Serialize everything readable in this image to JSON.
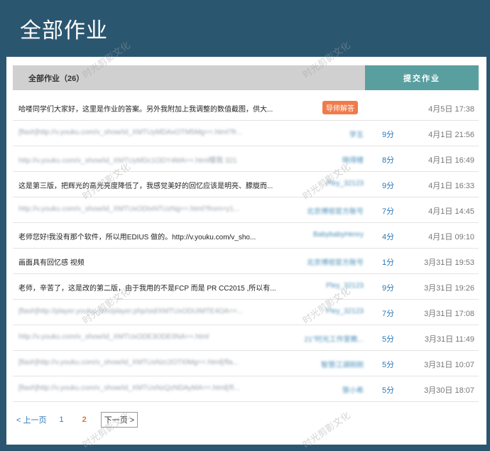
{
  "page": {
    "title": "全部作业"
  },
  "tabs": {
    "all_label": "全部作业（26）",
    "submit_label": "提交作业"
  },
  "badge_label": "导师解答",
  "rows": [
    {
      "title": "哈喽同学们大家好，这里是作业的答案。另外我附加上我调整的数值截图，供大...",
      "blurred": false,
      "author": "",
      "score": "",
      "time": "4月5日 17:38",
      "badge": true
    },
    {
      "title": "[flash]http://v.youku.com/v_show/id_XMTUyMDAxOTM5Mg==.html?fr...",
      "blurred": true,
      "author": "学五",
      "score": "9分",
      "time": "4月1日 21:56",
      "badge": false
    },
    {
      "title": "http://v.youku.com/v_show/id_XMTUyMDc1ODY4MA==.html曝我  321",
      "blurred": true,
      "author": "晓得楼",
      "score": "8分",
      "time": "4月1日 16:49",
      "badge": false
    },
    {
      "title": "这是第三版，把辉光的高光亮度降低了，我感觉美好的回忆应该是明亮、朦胧而...",
      "blurred": false,
      "author": "Pley_32123",
      "score": "9分",
      "time": "4月1日 16:33",
      "badge": false
    },
    {
      "title": "http://v.youku.com/v_show/id_XMTUxODIxNTUzNg==.html?from=y1...",
      "blurred": true,
      "author": "北京博视官方账号",
      "score": "7分",
      "time": "4月1日 14:45",
      "badge": false
    },
    {
      "title": "老师您好!我没有那个软件，所以用EDIUS 做的。http://v.youku.com/v_sho...",
      "blurred": false,
      "author": "BabybabyHenry",
      "score": "4分",
      "time": "4月1日 09:10",
      "badge": false
    },
    {
      "title": "画面具有回忆感 视频",
      "blurred": false,
      "author": "北京博视官方账号",
      "score": "1分",
      "time": "3月31日 19:53",
      "badge": false
    },
    {
      "title": "老师，辛苦了，这是改的第二版，由于我用的不是FCP 而是 PR CC2015 ,所以有...",
      "blurred": false,
      "author": "Pley_32123",
      "score": "9分",
      "time": "3月31日 19:26",
      "badge": false
    },
    {
      "title": "[flash]http://player.youku.com/player.php/sid/XMTUxODUIMTE4OA==...",
      "blurred": true,
      "author": "Pley_32123",
      "score": "7分",
      "time": "3月31日 17:08",
      "badge": false
    },
    {
      "title": "http://v.youku.com/v_show/id_XMTUxODE3ODE0NA==.html",
      "blurred": true,
      "author": "21°时光工作室教...",
      "score": "5分",
      "time": "3月31日 11:49",
      "badge": false
    },
    {
      "title": "[flash]http://v.youku.com/v_show/id_XMTUxNzc2OTI0Mg==.html[/fla...",
      "blurred": true,
      "author": "智慧江湖刚刚",
      "score": "5分",
      "time": "3月31日 10:07",
      "badge": false
    },
    {
      "title": "[flash]http://v.youku.com/v_show/id_XMTUxNzQzNDAyMA==.html[/fl...",
      "blurred": true,
      "author": "張小希",
      "score": "5分",
      "time": "3月30日 18:07",
      "badge": false
    }
  ],
  "pager": {
    "prev": "< 上一页",
    "p1": "1",
    "p2": "2",
    "next": "下一页 >"
  },
  "watermark": "时光剪影文化"
}
